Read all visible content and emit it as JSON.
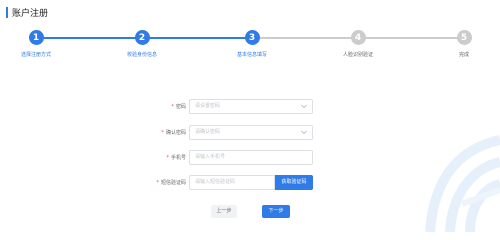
{
  "header": {
    "title": "账户注册"
  },
  "steps": [
    {
      "number": "1",
      "label": "选择注册方式",
      "status": "done"
    },
    {
      "number": "2",
      "label": "校验身份信息",
      "status": "done"
    },
    {
      "number": "3",
      "label": "基本信息填写",
      "status": "active"
    },
    {
      "number": "4",
      "label": "人脸识别验证",
      "status": "pending"
    },
    {
      "number": "5",
      "label": "完成",
      "status": "pending"
    }
  ],
  "colors": {
    "accent": "#2f7be8",
    "pending": "#cccccc",
    "required": "#e84b3c"
  },
  "form": {
    "password": {
      "label": "密码",
      "placeholder": "请设置密码"
    },
    "confirm_password": {
      "label": "确认密码",
      "placeholder": "请确认密码"
    },
    "phone": {
      "label": "手机号",
      "placeholder": "请输入手机号"
    },
    "sms_code": {
      "label": "短信验证码",
      "placeholder": "请输入短信验证码",
      "send_button": "获取验证码"
    }
  },
  "buttons": {
    "prev": "上一步",
    "next": "下一步"
  },
  "icons": {
    "field_toggle": "chevron-down-icon",
    "watermark": "logo-watermark"
  }
}
